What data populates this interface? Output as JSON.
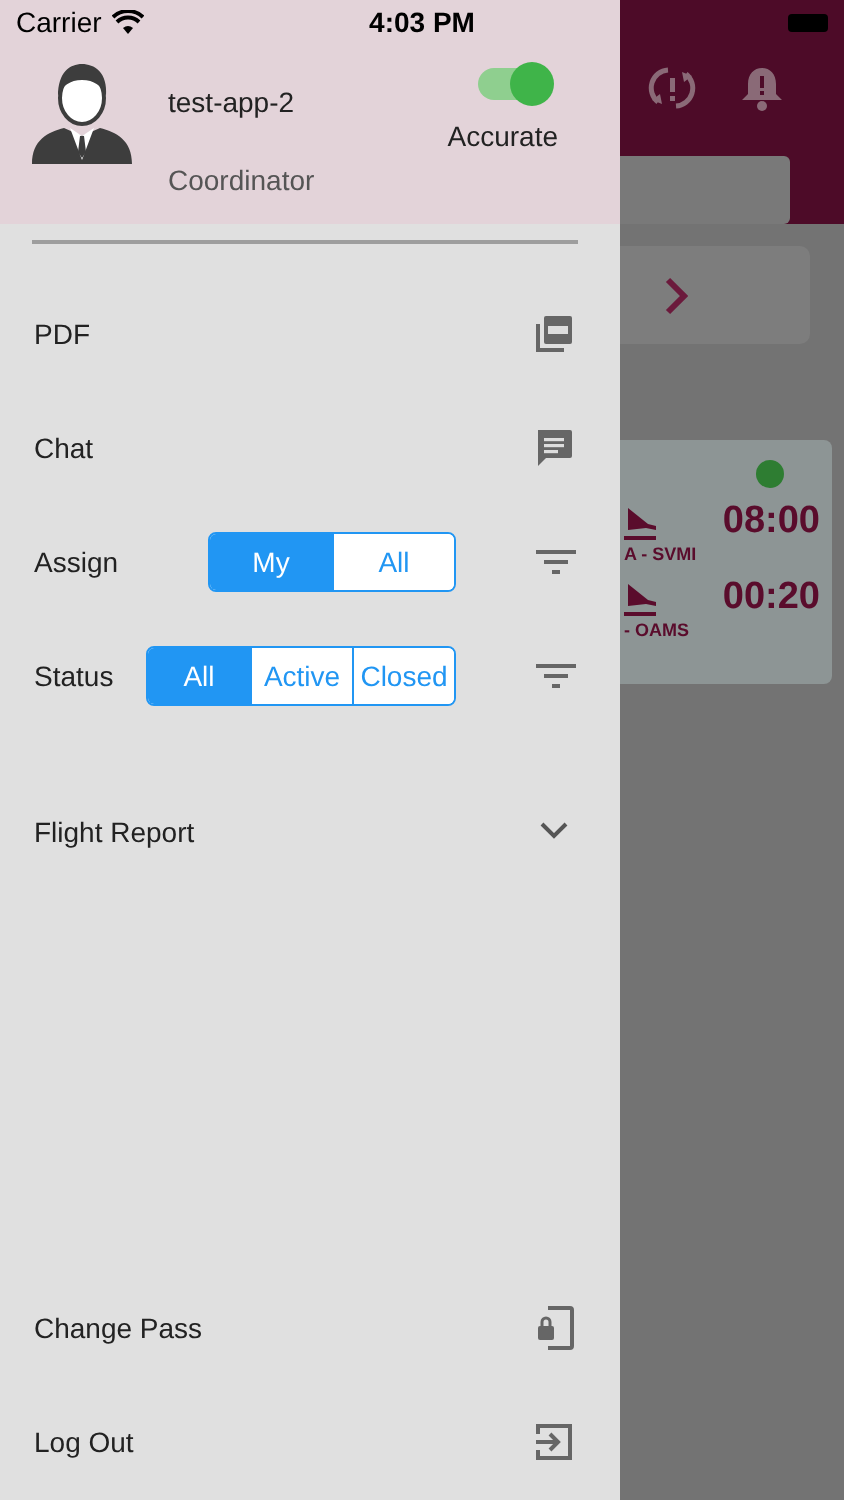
{
  "status_bar": {
    "carrier": "Carrier",
    "time": "4:03 PM"
  },
  "profile": {
    "name": "test-app-2",
    "role": "Coordinator",
    "toggle": {
      "label": "Accurate",
      "on": true
    }
  },
  "menu": [
    {
      "label": "PDF",
      "kind": "pdf"
    },
    {
      "label": "Chat",
      "kind": "chat"
    }
  ],
  "filters": [
    {
      "label": "Assign",
      "options": [
        {
          "label": "My",
          "selected": true
        },
        {
          "label": "All",
          "selected": false
        }
      ]
    },
    {
      "label": "Status",
      "options": [
        {
          "label": "All",
          "selected": true
        },
        {
          "label": "Active",
          "selected": false
        },
        {
          "label": "Closed",
          "selected": false
        }
      ]
    }
  ],
  "flight_report": {
    "label": "Flight Report",
    "expanded": false
  },
  "bottom_menu": [
    {
      "label": "Change Pass",
      "kind": "lock"
    },
    {
      "label": "Log Out",
      "kind": "logout"
    }
  ],
  "flights": [
    {
      "color": "#2e7d32",
      "legs": [
        {
          "route": "A - SVMI",
          "time": "08:00"
        },
        {
          "route": "- OAMS",
          "time": "00:20"
        }
      ]
    }
  ]
}
